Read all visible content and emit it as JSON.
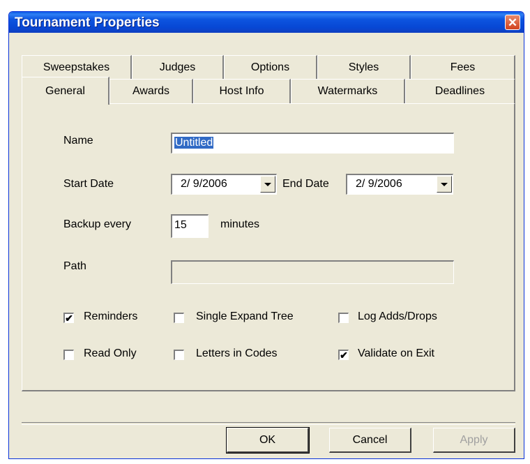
{
  "window": {
    "title": "Tournament Properties",
    "close_label": "✕"
  },
  "tabs": {
    "row_back": [
      "Sweepstakes",
      "Judges",
      "Options",
      "Styles",
      "Fees"
    ],
    "row_front": [
      "General",
      "Awards",
      "Host Info",
      "Watermarks",
      "Deadlines"
    ],
    "active": "General"
  },
  "form": {
    "name_label": "Name",
    "name_value": "Untitled",
    "start_date_label": "Start Date",
    "start_date_value": "2/ 9/2006",
    "end_date_label": "End Date",
    "end_date_value": "2/ 9/2006",
    "backup_label": "Backup every",
    "backup_value": "15",
    "backup_unit": "minutes",
    "path_label": "Path",
    "path_value": ""
  },
  "checkboxes": [
    {
      "label": "Reminders",
      "checked": true
    },
    {
      "label": "Single Expand Tree",
      "checked": false
    },
    {
      "label": "Log Adds/Drops",
      "checked": false
    },
    {
      "label": "Read Only",
      "checked": false
    },
    {
      "label": "Letters in Codes",
      "checked": false
    },
    {
      "label": "Validate on Exit",
      "checked": true
    }
  ],
  "buttons": {
    "ok": "OK",
    "cancel": "Cancel",
    "apply": "Apply"
  },
  "colors": {
    "titlebar": "#0a5ae6",
    "dialog_bg": "#ece9d8",
    "selection": "#316ac5"
  }
}
